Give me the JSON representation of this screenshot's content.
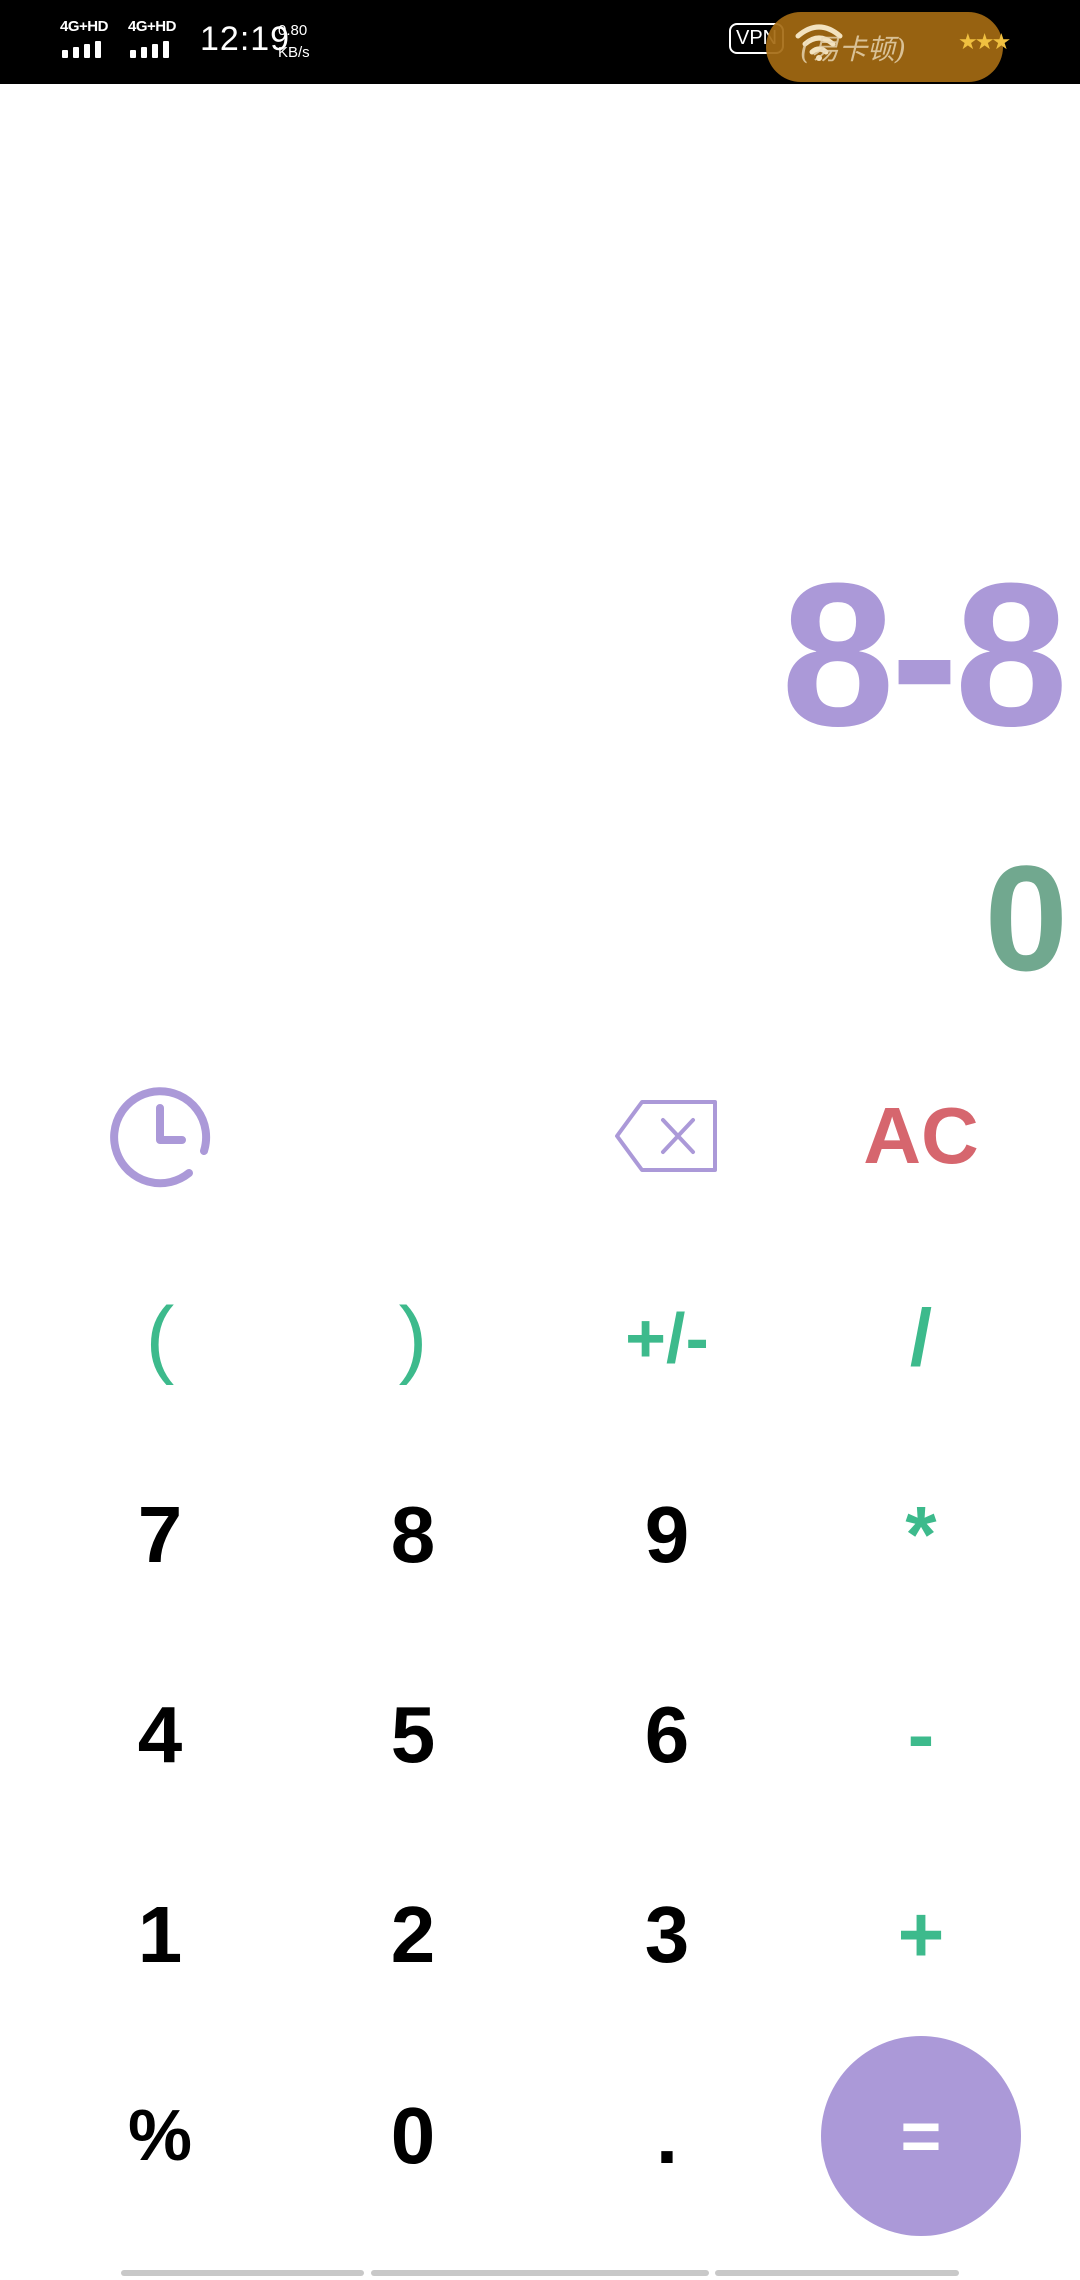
{
  "status_bar": {
    "network1": "4G+HD",
    "network2": "4G+HD",
    "time": "12:19",
    "speed_value": "0.80",
    "speed_unit": "KB/s",
    "vpn": "VPN",
    "overlay_text": "(易卡顿)"
  },
  "display": {
    "expression": "8-8",
    "result": "0"
  },
  "keys": {
    "history_icon": "clock-icon",
    "backspace_icon": "backspace-icon",
    "clear": "AC",
    "open_paren": "(",
    "close_paren": ")",
    "sign": "+/-",
    "divide": "/",
    "seven": "7",
    "eight": "8",
    "nine": "9",
    "multiply": "*",
    "four": "4",
    "five": "5",
    "six": "6",
    "subtract": "-",
    "one": "1",
    "two": "2",
    "three": "3",
    "add": "+",
    "percent": "%",
    "zero": "0",
    "decimal": ".",
    "equals": "="
  },
  "colors": {
    "accent_purple": "#ab99d8",
    "operator_green": "#3dba8c",
    "clear_red": "#d6666e",
    "result_green": "#71a88f"
  }
}
